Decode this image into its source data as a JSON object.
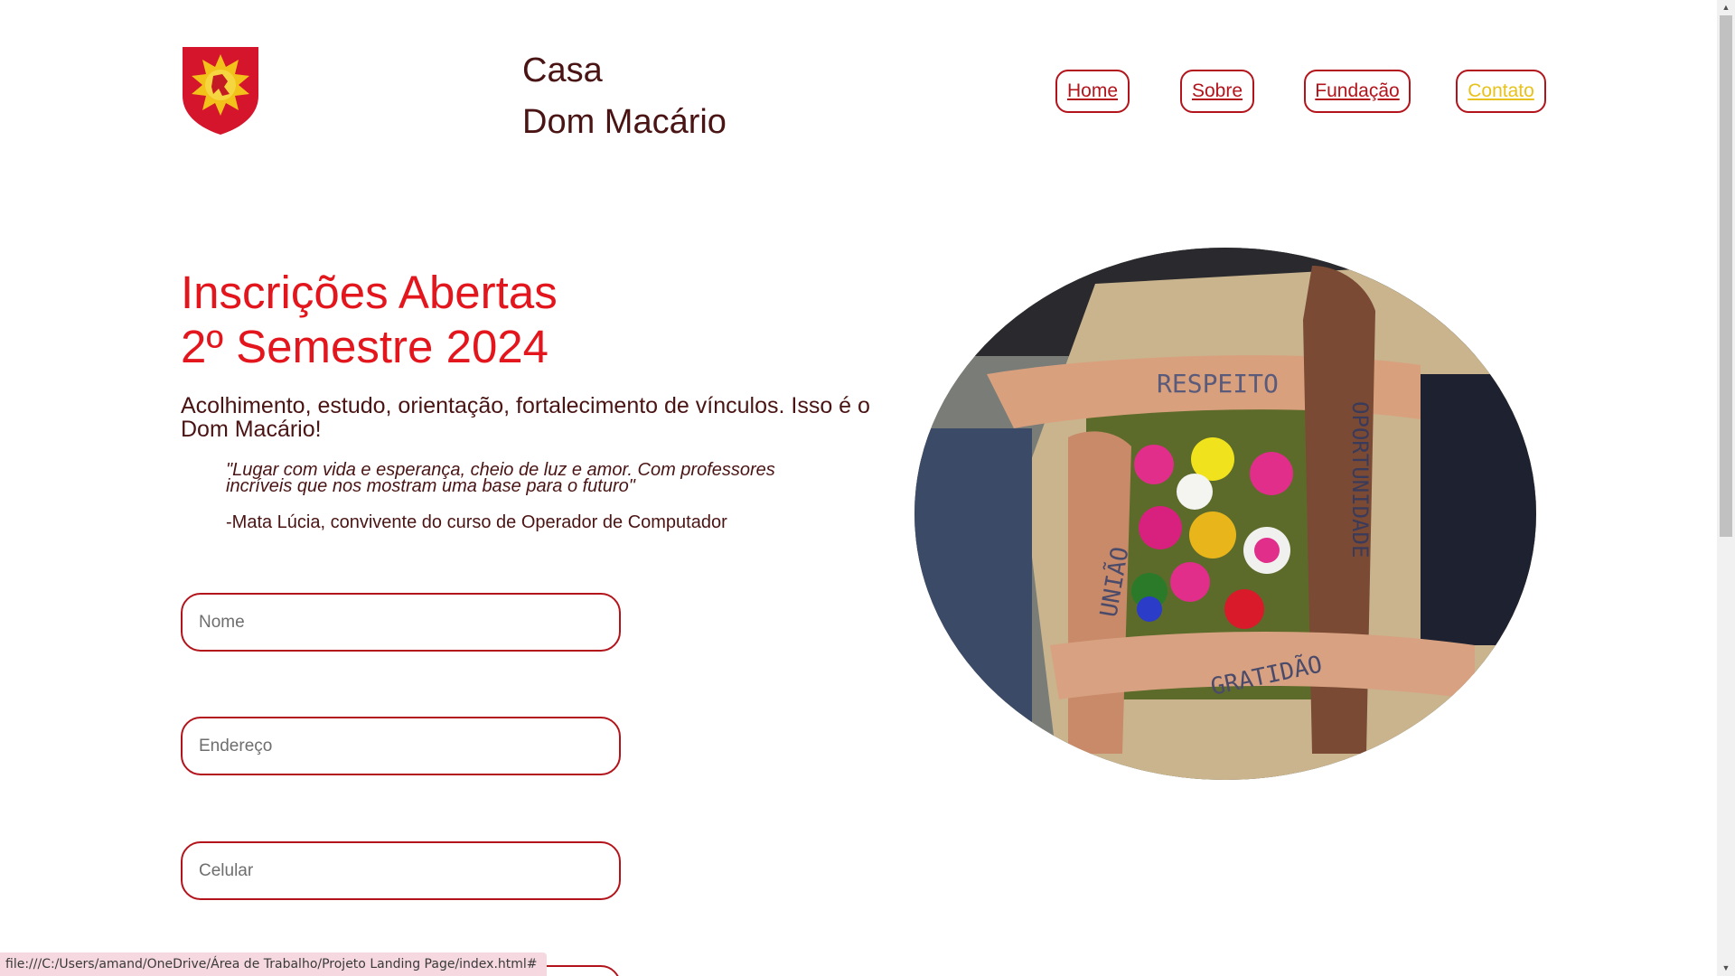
{
  "header": {
    "brand_line1": "Casa",
    "brand_line2": "Dom Macário",
    "nav": [
      {
        "label": "Home"
      },
      {
        "label": "Sobre"
      },
      {
        "label": "Fundação"
      },
      {
        "label": "Contato"
      }
    ]
  },
  "hero": {
    "headline_line1": "Inscrições Abertas",
    "headline_line2": "2º Semestre 2024",
    "subtitle": "Acolhimento, estudo, orientação, fortalecimento de vínculos. Isso é o Dom Macário!",
    "quote": "\"Lugar com vida e esperança, cheio de luz e amor. Com professores incríveis que nos mostram uma base para o futuro\"",
    "quote_author": "-Mata Lúcia, convivente do curso de Operador de Computador"
  },
  "form": {
    "name_placeholder": "Nome",
    "address_placeholder": "Endereço",
    "phone_placeholder": "Celular",
    "fourth_placeholder": ""
  },
  "photo": {
    "words": [
      "RESPEITO",
      "OPORTUNIDADE",
      "UNIÃO",
      "GRATIDÃO"
    ]
  },
  "statusbar": {
    "url": "file:///C:/Users/amand/OneDrive/Área de Trabalho/Projeto Landing Page/index.html#"
  },
  "colors": {
    "accent": "#e3161d",
    "border": "#b3141b",
    "text": "#4a1414",
    "contact_link": "#e8c21a"
  }
}
